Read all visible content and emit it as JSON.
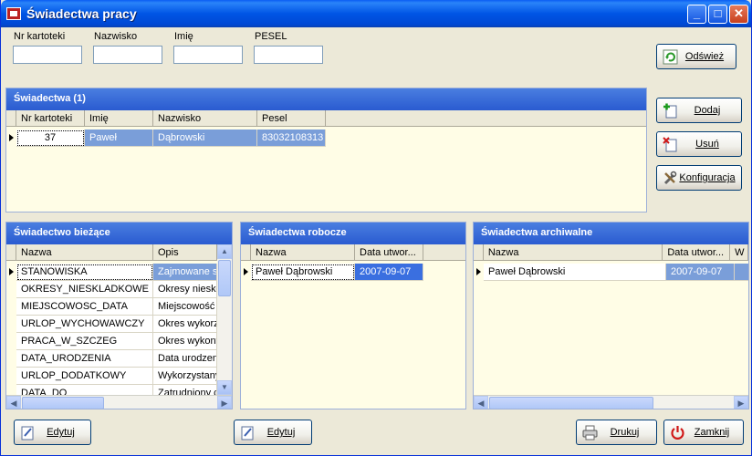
{
  "window": {
    "title": "Świadectwa pracy"
  },
  "filters": [
    {
      "label": "Nr kartoteki",
      "value": ""
    },
    {
      "label": "Nazwisko",
      "value": ""
    },
    {
      "label": "Imię",
      "value": ""
    },
    {
      "label": "PESEL",
      "value": ""
    }
  ],
  "buttons": {
    "refresh": "Odśwież",
    "add": "Dodaj",
    "delete": "Usuń",
    "config": "Konfiguracja",
    "edit_current": "Edytuj",
    "edit_working": "Edytuj",
    "print": "Drukuj",
    "close": "Zamknij"
  },
  "certificates": {
    "title": "Świadectwa (1)",
    "columns": [
      "Nr kartoteki",
      "Imię",
      "Nazwisko",
      "Pesel"
    ],
    "rows": [
      {
        "nr": "37",
        "imie": "Paweł",
        "nazwisko": "Dąbrowski",
        "pesel": "83032108313"
      }
    ]
  },
  "current": {
    "title": "Świadectwo bieżące",
    "columns": [
      "Nazwa",
      "Opis"
    ],
    "rows": [
      {
        "nazwa": "STANOWISKA",
        "opis": "Zajmowane st"
      },
      {
        "nazwa": "OKRESY_NIESKLADKOWE",
        "opis": "Okresy nieskła"
      },
      {
        "nazwa": "MIEJSCOWOSC_DATA",
        "opis": "Miejscowość i"
      },
      {
        "nazwa": "URLOP_WYCHOWAWCZY",
        "opis": "Okres wykorz"
      },
      {
        "nazwa": "PRACA_W_SZCZEG",
        "opis": "Okres wykony"
      },
      {
        "nazwa": "DATA_URODZENIA",
        "opis": "Data urodzen"
      },
      {
        "nazwa": "URLOP_DODATKOWY",
        "opis": "Wykorzystany"
      },
      {
        "nazwa": "DATA_DO",
        "opis": "Zatrudniony c"
      }
    ]
  },
  "working": {
    "title": "Świadectwa robocze",
    "columns": [
      "Nazwa",
      "Data utwor..."
    ],
    "rows": [
      {
        "nazwa": "Paweł Dąbrowski",
        "data": "2007-09-07"
      }
    ]
  },
  "archive": {
    "title": "Świadectwa archiwalne",
    "columns": [
      "Nazwa",
      "Data utwor...",
      "W"
    ],
    "rows": [
      {
        "nazwa": "Paweł Dąbrowski",
        "data": "2007-09-07"
      }
    ]
  }
}
